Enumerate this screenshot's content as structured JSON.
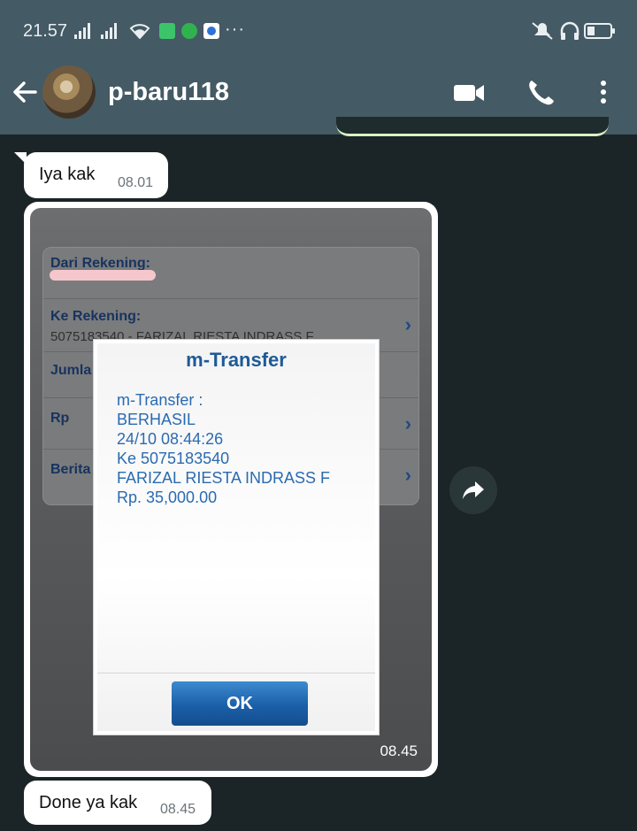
{
  "status_bar": {
    "time": "21.57",
    "more": "···",
    "icons": [
      "signal-icon",
      "signal-icon",
      "wifi-icon",
      "bbm-icon",
      "whatsapp-icon",
      "app-notification-icon",
      "mute-icon",
      "headphones-icon",
      "battery-icon"
    ]
  },
  "header": {
    "contact_name": "p-baru118",
    "icons": [
      "back-arrow-icon",
      "video-call-icon",
      "phone-call-icon",
      "more-vertical-icon"
    ]
  },
  "messages": {
    "m1": {
      "text": "Iya kak",
      "time": "08.01"
    },
    "image": {
      "time": "08.45",
      "background_form": {
        "dari_label": "Dari Rekening:",
        "ke_label": "Ke Rekening:",
        "ke_value": "5075183540 - FARIZAL RIESTA INDRASS F",
        "jumlah_label": "Jumla",
        "rp_label": "Rp",
        "berita_label": "Berita"
      },
      "dialog": {
        "title": "m-Transfer",
        "lines": [
          "m-Transfer :",
          "BERHASIL",
          "24/10 08:44:26",
          "Ke 5075183540",
          "FARIZAL RIESTA INDRASS F",
          "Rp. 35,000.00"
        ],
        "ok_label": "OK"
      }
    },
    "m2": {
      "text": "Done ya kak",
      "time": "08.45"
    }
  },
  "colors": {
    "header_bg": "#445a65",
    "chat_bg": "#1b2426",
    "bubble_bg": "#ffffff",
    "dialog_text": "#2a6bb0",
    "ok_button": "#1b5fa8"
  }
}
